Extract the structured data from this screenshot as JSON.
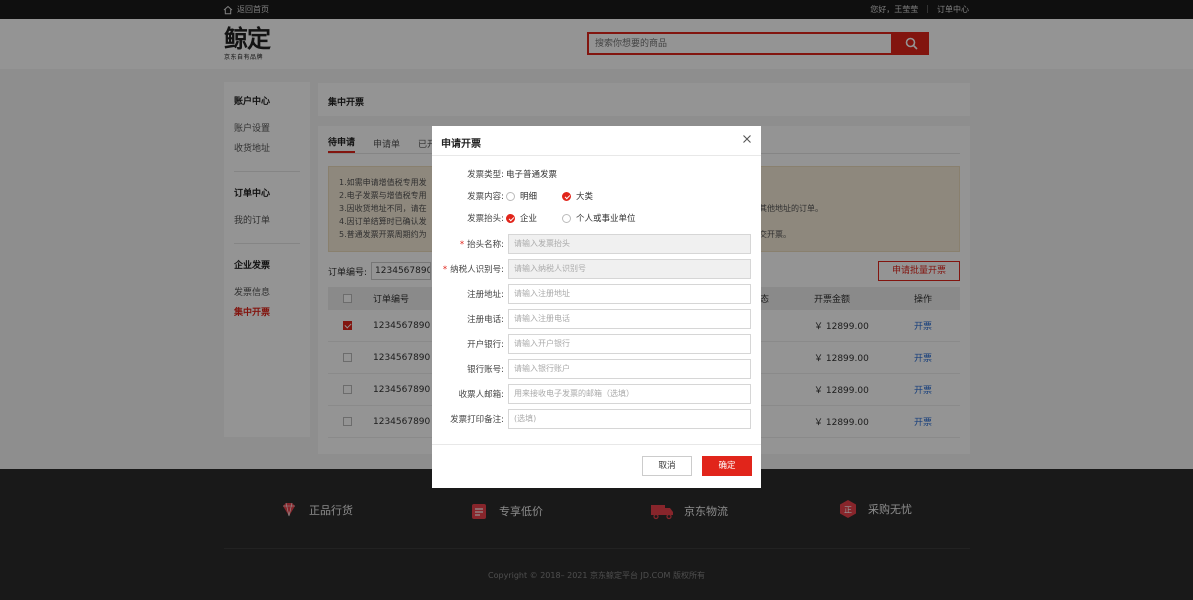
{
  "topbar": {
    "home": "返回首页",
    "greeting": "您好，王莹莹",
    "order_center": "订单中心"
  },
  "header": {
    "logo_main": "鲸定",
    "logo_sub": "京东自有品牌",
    "search_placeholder": "搜索你想要的商品"
  },
  "sidebar": {
    "groups": [
      {
        "title": "账户中心",
        "items": [
          "账户设置",
          "收货地址"
        ]
      },
      {
        "title": "订单中心",
        "items": [
          "我的订单"
        ]
      },
      {
        "title": "企业发票",
        "items": [
          "发票信息",
          "集中开票"
        ]
      }
    ]
  },
  "page": {
    "title": "集中开票",
    "tabs": [
      "待申请",
      "申请单",
      "已开"
    ],
    "notice": [
      "1.如需申请增值税专用发",
      "2.电子发票与增值税专用",
      "3.因收货地址不同，请在",
      "4.因订单结算时已确认发",
      "5.普通发票开票周期约为"
    ],
    "notice_tail": [
      "其他地址的订单。",
      "交开票。"
    ],
    "filter_label": "订单编号:",
    "filter_value": "1234567890",
    "batch_button": "申请批量开票",
    "table": {
      "headers": {
        "order_no": "订单编号",
        "status_tail": "态",
        "amount": "开票金额",
        "op": "操作"
      },
      "rows": [
        {
          "order_no": "1234567890",
          "amount": "￥ 12899.00",
          "op": "开票",
          "checked": true
        },
        {
          "order_no": "1234567890",
          "amount": "￥ 12899.00",
          "op": "开票",
          "checked": false
        },
        {
          "order_no": "1234567890",
          "amount": "￥ 12899.00",
          "op": "开票",
          "checked": false
        },
        {
          "order_no": "1234567890",
          "amount": "￥ 12899.00",
          "op": "开票",
          "checked": false
        }
      ]
    }
  },
  "footer": {
    "features": [
      "正品行货",
      "专享低价",
      "京东物流",
      "采购无忧"
    ],
    "copyright": "Copyright © 2018– 2021 京东鲸定平台 JD.COM 版权所有"
  },
  "modal": {
    "title": "申请开票",
    "invoice_type_label": "发票类型:",
    "invoice_type_value": "电子普通发票",
    "content_label": "发票内容:",
    "content_options": [
      "明细",
      "大类"
    ],
    "header_label": "发票抬头:",
    "header_options": [
      "企业",
      "个人或事业单位"
    ],
    "fields": [
      {
        "label": "抬头名称:",
        "placeholder": "请输入发票抬头",
        "required": true
      },
      {
        "label": "纳税人识别号:",
        "placeholder": "请输入纳税人识别号",
        "required": true
      },
      {
        "label": "注册地址:",
        "placeholder": "请输入注册地址",
        "required": false
      },
      {
        "label": "注册电话:",
        "placeholder": "请输入注册电话",
        "required": false
      },
      {
        "label": "开户银行:",
        "placeholder": "请输入开户银行",
        "required": false
      },
      {
        "label": "银行账号:",
        "placeholder": "请输入银行账户",
        "required": false
      },
      {
        "label": "收票人邮箱:",
        "placeholder": "用来接收电子发票的邮箱（选填）",
        "required": false
      },
      {
        "label": "发票打印备注:",
        "placeholder": "(选填)",
        "required": false
      }
    ],
    "cancel": "取消",
    "confirm": "确定"
  },
  "colors": {
    "accent": "#e1251b",
    "link": "#2b6fd6",
    "footer_bg": "#2b2b2b"
  }
}
